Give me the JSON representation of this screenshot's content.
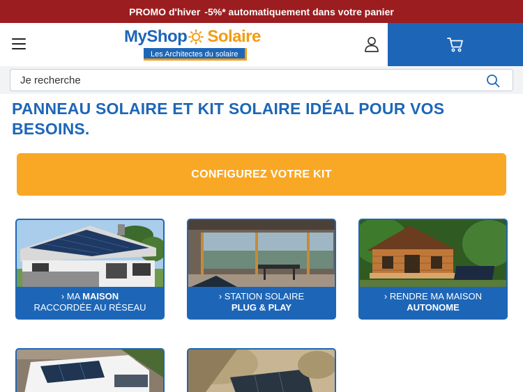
{
  "promo": {
    "part1": "PROMO d'hiver",
    "part2": "-5%* automatiquement dans votre panier"
  },
  "header": {
    "logo": {
      "my": "MyShop",
      "solaire": "Solaire",
      "tagline": "Les Architectes du solaire"
    },
    "icons": [
      "hamburger-menu-icon",
      "user-icon",
      "cart-icon",
      "search-icon"
    ]
  },
  "search": {
    "placeholder": "Je recherche"
  },
  "main": {
    "title": "PANNEAU SOLAIRE ET KIT SOLAIRE IDÉAL POUR VOS BESOINS.",
    "cta": "CONFIGUREZ VOTRE KIT",
    "cards": [
      {
        "prefix": "MA ",
        "strong": "MAISON",
        "line2": "RACCORDÉE AU RÉSEAU"
      },
      {
        "prefix": "STATION SOLAIRE",
        "strong": "",
        "line2": "PLUG & PLAY"
      },
      {
        "prefix": "RENDRE MA MAISON",
        "strong": "",
        "line2": "AUTONOME"
      }
    ]
  },
  "colors": {
    "promo_bg": "#9c1d1f",
    "brand_blue": "#1d66b7",
    "brand_orange": "#f9a825"
  }
}
